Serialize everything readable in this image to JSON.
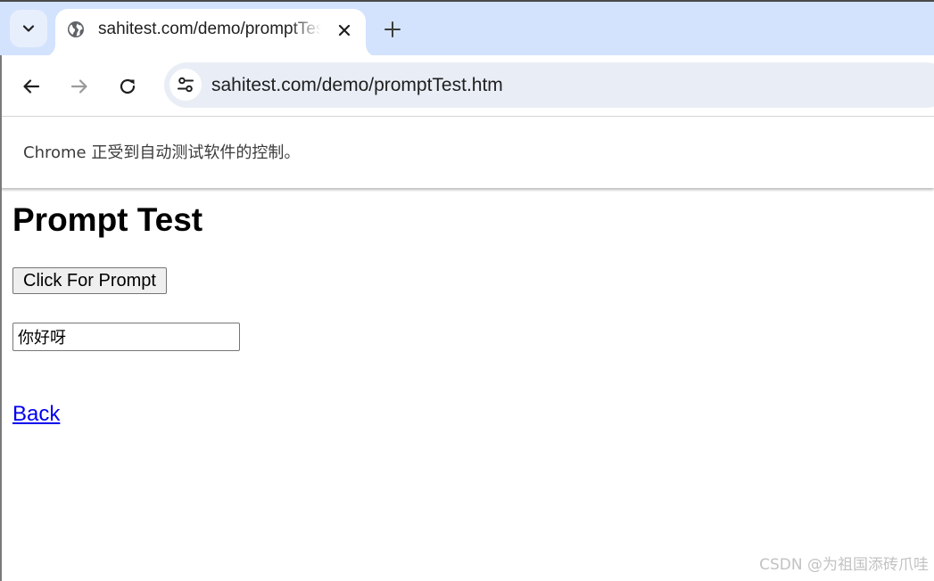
{
  "browser": {
    "tab": {
      "title": "sahitest.com/demo/promptTest.htm",
      "favicon": "globe-icon",
      "close_icon": "close-icon"
    },
    "tab_search_icon": "chevron-down-icon",
    "new_tab_icon": "plus-icon",
    "toolbar": {
      "back_icon": "arrow-left-icon",
      "forward_icon": "arrow-right-icon",
      "reload_icon": "reload-icon",
      "site_info_icon": "tune-icon",
      "url": "sahitest.com/demo/promptTest.htm"
    },
    "infobar": {
      "message": "Chrome 正受到自动测试软件的控制。"
    },
    "colors": {
      "tabstrip": "#d3e3fd",
      "omnibox": "#e9eef6",
      "link": "#0000ee"
    }
  },
  "page": {
    "title": "Prompt Test",
    "prompt_button_label": "Click For Prompt",
    "result_input_value": "你好呀",
    "back_link": "Back"
  },
  "watermark": "CSDN @为祖国添砖爪哇"
}
